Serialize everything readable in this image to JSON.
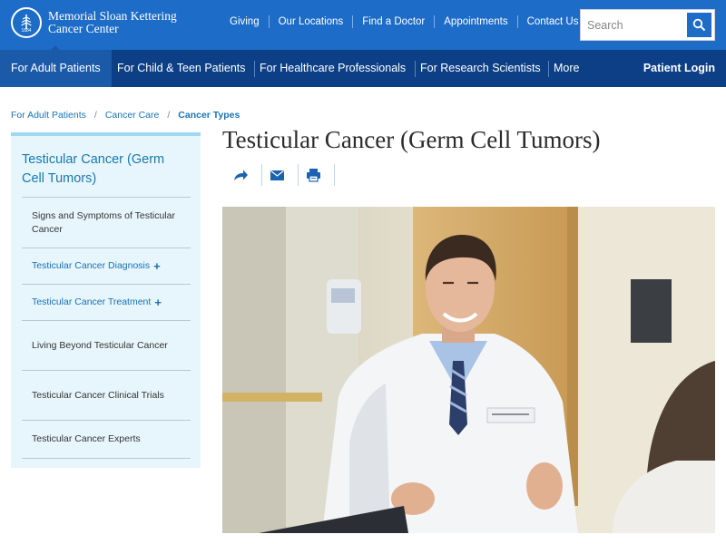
{
  "header": {
    "logo_line1": "Memorial Sloan Kettering",
    "logo_line2": "Cancer Center",
    "seal_year": "1884",
    "utility_links": [
      "Giving",
      "Our Locations",
      "Find a Doctor",
      "Appointments",
      "Contact Us"
    ],
    "search_placeholder": "Search"
  },
  "mainnav": {
    "tabs": [
      "For Adult Patients",
      "For Child & Teen Patients",
      "For Healthcare Professionals",
      "For Research Scientists",
      "More"
    ],
    "active_index": 0,
    "login_label": "Patient Login"
  },
  "breadcrumb": [
    "For Adult Patients",
    "Cancer Care",
    "Cancer Types"
  ],
  "sidebar": {
    "title": "Testicular Cancer (Germ Cell Tumors)",
    "items": [
      {
        "label": "Signs and Symptoms of Testicular Cancer",
        "expandable": false
      },
      {
        "label": "Testicular Cancer Diagnosis",
        "expandable": true
      },
      {
        "label": "Testicular Cancer Treatment",
        "expandable": true
      },
      {
        "label": "Living Beyond Testicular Cancer",
        "expandable": false
      },
      {
        "label": "Testicular Cancer Clinical Trials",
        "expandable": false
      },
      {
        "label": "Testicular Cancer Experts",
        "expandable": false
      }
    ]
  },
  "content": {
    "title": "Testicular Cancer (Germ Cell Tumors)",
    "share_tools": [
      "share-icon",
      "email-icon",
      "print-icon"
    ]
  },
  "colors": {
    "topbar": "#1d6cc8",
    "mainnav": "#0d3f86",
    "active_tab": "#1b5aa8",
    "sidebar_bg": "#e7f6fc",
    "link_blue": "#1a73b6"
  }
}
